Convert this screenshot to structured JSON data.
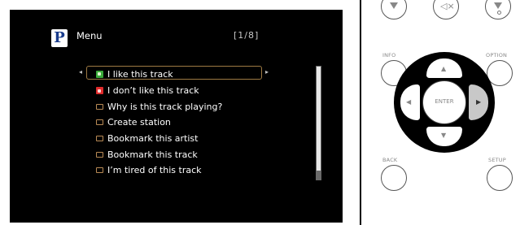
{
  "screen": {
    "logo_letter": "P",
    "menu_title": "Menu",
    "page_indicator": "[1/8]",
    "nav_left_glyph": "◂",
    "nav_right_glyph": "▸",
    "items": [
      {
        "label": "I like this track",
        "icon": "thumbs-up-icon",
        "selected": true
      },
      {
        "label": "I don’t like this track",
        "icon": "thumbs-down-icon",
        "selected": false
      },
      {
        "label": "Why is this track playing?",
        "icon": "menu-item-icon",
        "selected": false
      },
      {
        "label": "Create station",
        "icon": "menu-item-icon",
        "selected": false
      },
      {
        "label": "Bookmark this artist",
        "icon": "menu-item-icon",
        "selected": false
      },
      {
        "label": "Bookmark this track",
        "icon": "menu-item-icon",
        "selected": false
      },
      {
        "label": "I’m tired of this track",
        "icon": "menu-item-icon",
        "selected": false
      }
    ],
    "colors": {
      "background": "#000000",
      "selection_border": "#9e7a43",
      "like": "#3aaa3a",
      "dislike": "#e02b2b"
    }
  },
  "remote": {
    "labels": {
      "info": "INFO",
      "option": "OPTION",
      "back": "BACK",
      "setup": "SETUP",
      "enter": "ENTER"
    },
    "highlighted_button": "right"
  }
}
